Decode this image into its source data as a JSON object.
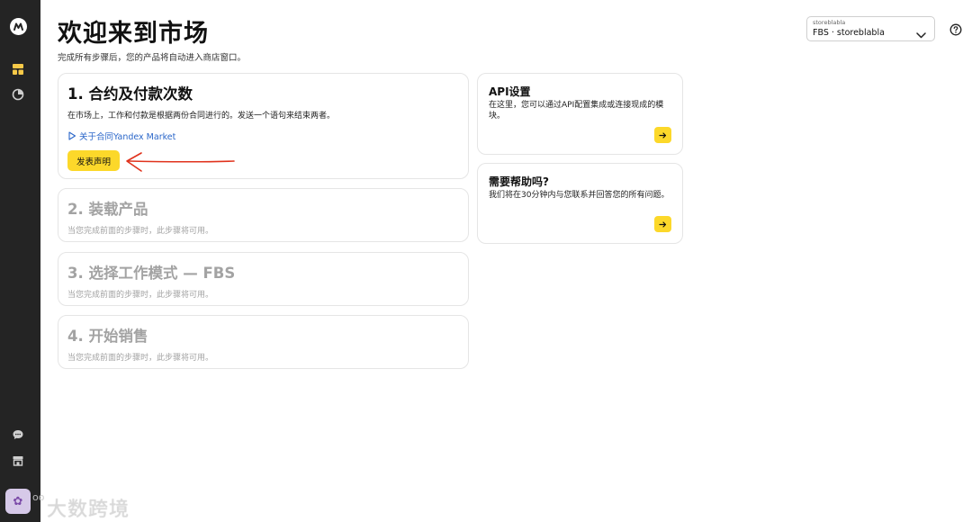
{
  "header": {
    "title": "欢迎来到市场",
    "subtitle": "完成所有步骤后，您的产品将自动进入商店窗口。"
  },
  "store_select": {
    "label": "storeblabla",
    "value": "FBS · storeblabla"
  },
  "steps": [
    {
      "title": "1. 合约及付款次数",
      "description": "在市场上，工作和付款是根据两份合同进行的。发送一个语句来结束两者。",
      "link": "关于合同Yandex Market",
      "button": "发表声明",
      "active": true
    },
    {
      "title": "2. 装载产品",
      "description": "当您完成前面的步骤时，此步骤将可用。",
      "active": false
    },
    {
      "title": "3. 选择工作模式 — FBS",
      "description": "当您完成前面的步骤时，此步骤将可用。",
      "active": false
    },
    {
      "title": "4. 开始销售",
      "description": "当您完成前面的步骤时，此步骤将可用。",
      "active": false
    }
  ],
  "side_cards": {
    "api": {
      "title": "API设置",
      "description": "在这里，您可以通过API配置集成或连接现成的模块。"
    },
    "help": {
      "title": "需要帮助吗?",
      "description": "我们将在30分钟内与您联系并回答您的所有问题。"
    }
  },
  "watermark": "大数跨境",
  "colors": {
    "sidebar": "#242424",
    "accent": "#fcd82a",
    "link": "#2a66c9",
    "annotation": "#e0321c",
    "disabled_text": "#a3a3a3"
  },
  "icons": {
    "logo": "market-logo-icon",
    "nav_dashboard": "dashboard-icon",
    "nav_analytics": "pie-chart-icon",
    "chat": "chat-icon",
    "store": "store-icon",
    "help": "question-circle-icon",
    "link": "play-outline-icon",
    "arrow": "arrow-right-icon"
  }
}
